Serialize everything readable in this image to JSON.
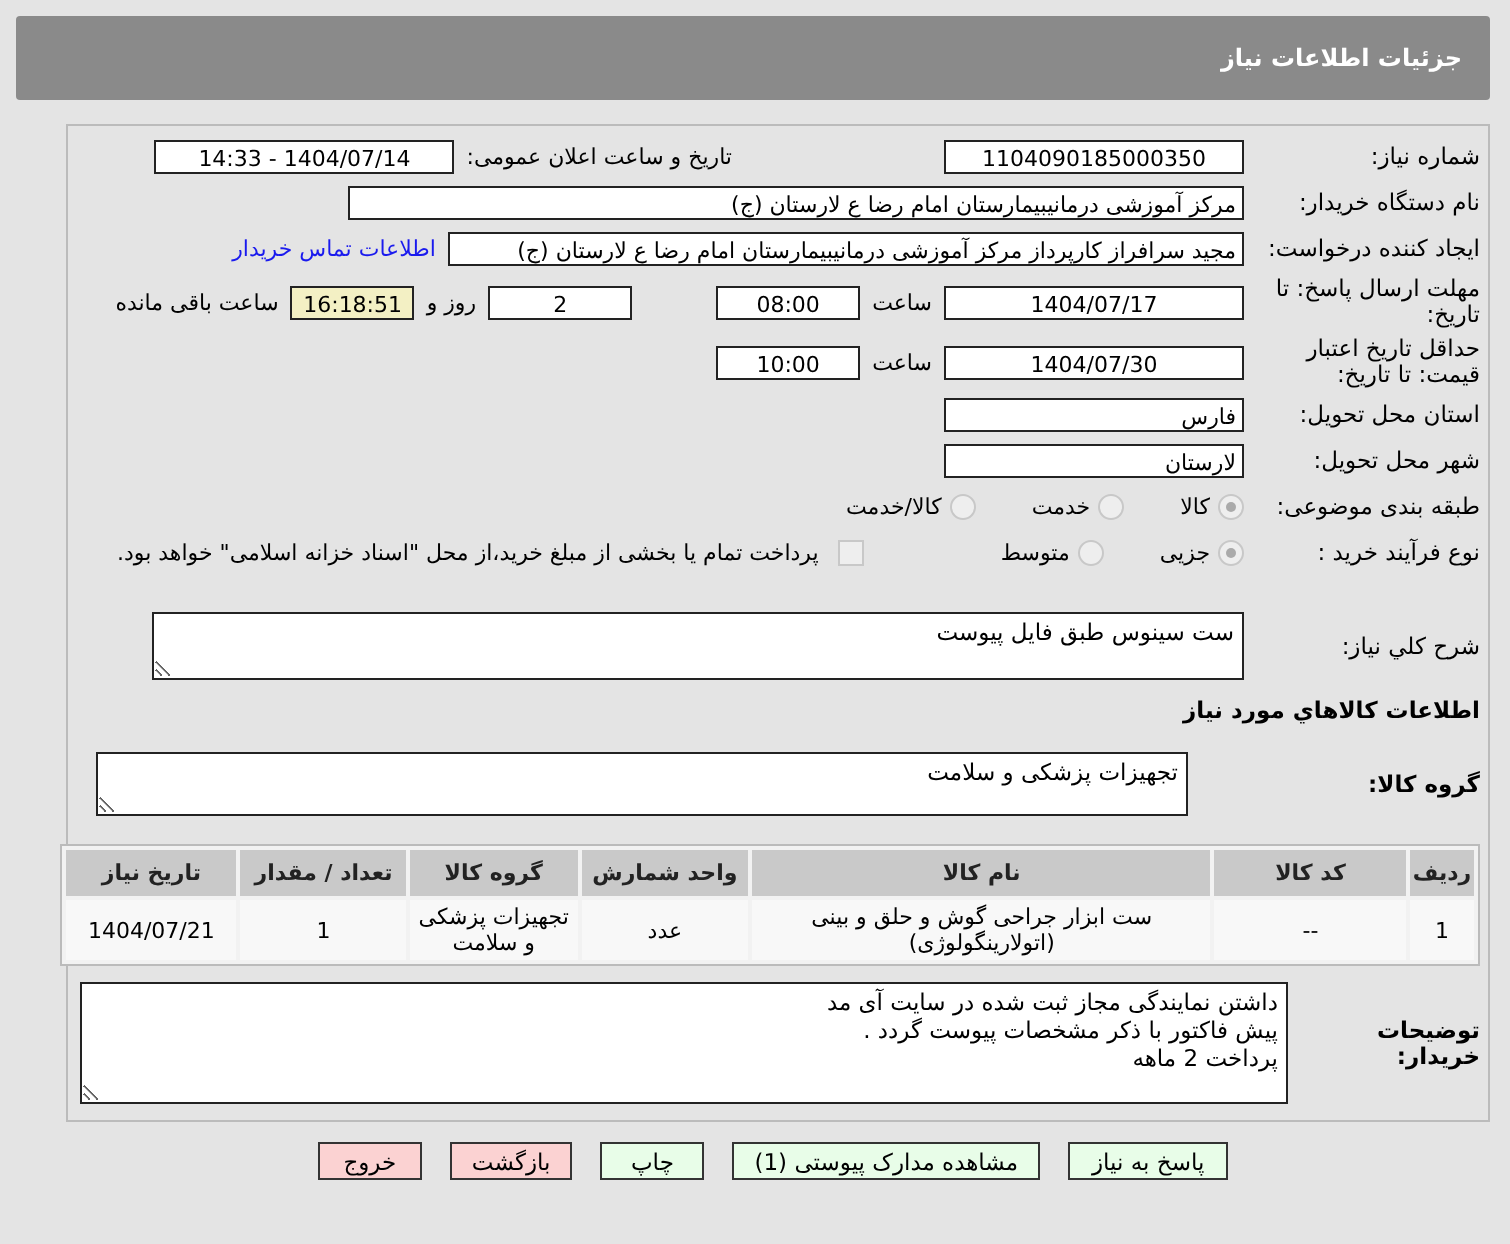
{
  "header": {
    "title": "جزئیات اطلاعات نیاز"
  },
  "need_number": {
    "label": "شماره نیاز:",
    "value": "1104090185000350"
  },
  "announce": {
    "label": "تاریخ و ساعت اعلان عمومی:",
    "value": "1404/07/14 - 14:33"
  },
  "buyer_org": {
    "label": "نام دستگاه خریدار:",
    "value": "مرکز آموزشی درمانیبیمارستان امام رضا  ع  لارستان (ج)"
  },
  "requester": {
    "label": "ایجاد کننده درخواست:",
    "value": "مجید سرافراز کارپرداز  مرکز آموزشی درمانیبیمارستان امام رضا  ع  لارستان (ج)",
    "link": "اطلاعات تماس خریدار"
  },
  "deadline": {
    "label": "مهلت ارسال پاسخ: تا تاریخ:",
    "date": "1404/07/17",
    "time_label": "ساعت",
    "time": "08:00",
    "days": "2",
    "days_label": "روز و",
    "remaining": "16:18:51",
    "remaining_label": "ساعت باقی مانده"
  },
  "validity": {
    "label": "حداقل تاریخ اعتبار قیمت: تا تاریخ:",
    "date": "1404/07/30",
    "time_label": "ساعت",
    "time": "10:00"
  },
  "province": {
    "label": "استان محل تحویل:",
    "value": "فارس"
  },
  "city": {
    "label": "شهر محل تحویل:",
    "value": "لارستان"
  },
  "category": {
    "label": "طبقه بندی موضوعی:",
    "options": [
      {
        "label": "کالا",
        "selected": true
      },
      {
        "label": "خدمت",
        "selected": false
      },
      {
        "label": "کالا/خدمت",
        "selected": false
      }
    ]
  },
  "purchase_type": {
    "label": "نوع فرآیند خرید :",
    "options": [
      {
        "label": "جزیی",
        "selected": true
      },
      {
        "label": "متوسط",
        "selected": false
      }
    ],
    "treasury": {
      "label": "پرداخت تمام یا بخشی از مبلغ خرید،از محل \"اسناد خزانه اسلامی\" خواهد بود.",
      "checked": false
    }
  },
  "summary": {
    "label": "شرح کلي نیاز:",
    "value": "ست سینوس طبق فایل پیوست"
  },
  "goods_title": "اطلاعات کالاهاي مورد نیاز",
  "goods_group": {
    "label": "گروه کالا:",
    "value": "تجهیزات پزشکی و سلامت"
  },
  "table": {
    "columns": [
      "ردیف",
      "کد کالا",
      "نام کالا",
      "واحد شمارش",
      "گروه کالا",
      "تعداد / مقدار",
      "تاریخ نیاز"
    ],
    "rows": [
      [
        "1",
        "--",
        "ست ابزار جراحی گوش و حلق و بینی (اتولارینگولوژی)",
        "عدد",
        "تجهیزات پزشکی و سلامت",
        "1",
        "1404/07/21"
      ]
    ]
  },
  "buyer_notes": {
    "label": "توضیحات خریدار:",
    "value": "داشتن نمایندگی مجاز ثبت شده در سایت آی مد\nپیش فاکتور با ذکر مشخصات پیوست گردد .\nپرداخت 2 ماهه"
  },
  "buttons": [
    {
      "label": "پاسخ به نیاز",
      "kind": "normal"
    },
    {
      "label": "مشاهده مدارک پیوستی (1)",
      "kind": "normal"
    },
    {
      "label": "چاپ",
      "kind": "normal"
    },
    {
      "label": "بازگشت",
      "kind": "danger"
    },
    {
      "label": "خروج",
      "kind": "danger"
    }
  ]
}
